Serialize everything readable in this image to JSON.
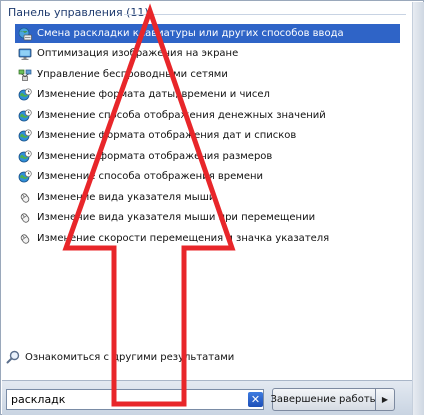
{
  "group_header": "Панель управления (11)",
  "items": [
    {
      "label": "Смена раскладки клавиатуры или других способов ввода",
      "icon": "globe-keyboard-icon",
      "selected": true
    },
    {
      "label": "Оптимизация изображения на экране",
      "icon": "display-icon",
      "selected": false
    },
    {
      "label": "Управление беспроводными сетями",
      "icon": "network-icon",
      "selected": false
    },
    {
      "label": "Изменение формата даты, времени и чисел",
      "icon": "globe-clock-icon",
      "selected": false
    },
    {
      "label": "Изменение способа отображения денежных значений",
      "icon": "globe-clock-icon",
      "selected": false
    },
    {
      "label": "Изменение формата отображения дат и списков",
      "icon": "globe-clock-icon",
      "selected": false
    },
    {
      "label": "Изменение формата отображения размеров",
      "icon": "globe-clock-icon",
      "selected": false
    },
    {
      "label": "Изменение способа отображения времени",
      "icon": "globe-clock-icon",
      "selected": false
    },
    {
      "label": "Изменение вида указателя мыши",
      "icon": "mouse-icon",
      "selected": false
    },
    {
      "label": "Изменение вида указателя мыши при перемещении",
      "icon": "mouse-icon",
      "selected": false
    },
    {
      "label": "Изменение скорости перемещения и значка указателя",
      "icon": "mouse-icon",
      "selected": false
    }
  ],
  "more_results": "Ознакомиться с другими результатами",
  "search": {
    "value": "раскладк"
  },
  "shutdown_label": "Завершение работы",
  "colors": {
    "selection": "#2f64c7",
    "annotation_arrow": "#e8262a"
  }
}
